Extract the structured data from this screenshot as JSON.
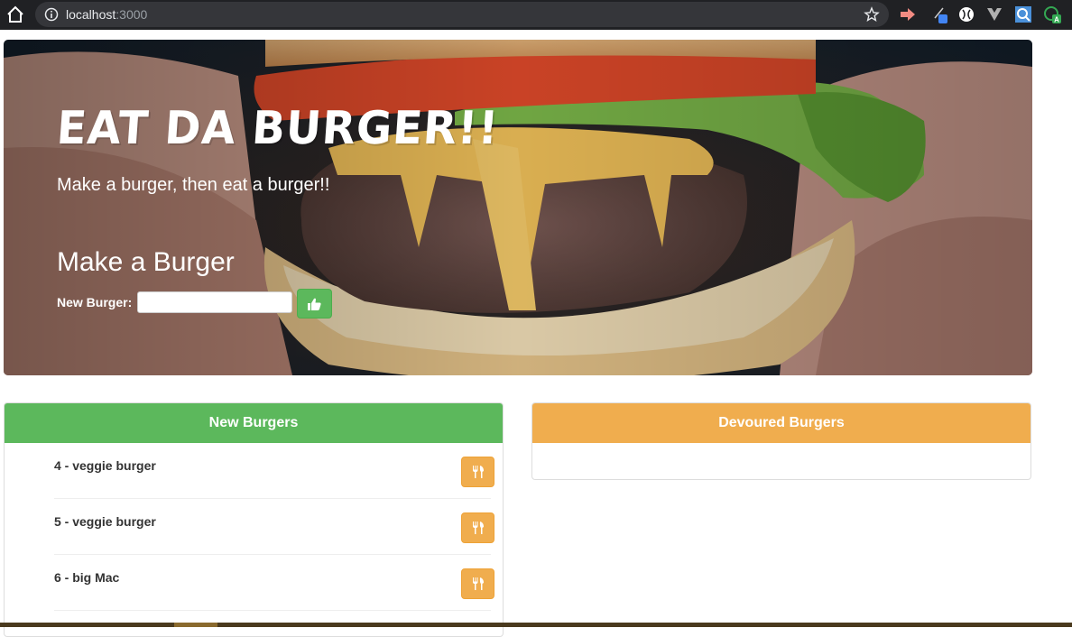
{
  "browser": {
    "url_host": "localhost",
    "url_port": ":3000"
  },
  "hero": {
    "title": "Eat Da Burger!!",
    "subtitle": "Make a burger, then eat a burger!!",
    "form_title": "Make a Burger",
    "input_label": "New Burger:",
    "input_value": "",
    "input_placeholder": "",
    "submit_icon": "thumbs-up-icon"
  },
  "panels": {
    "new": {
      "title": "New Burgers",
      "color": "#5cb85c",
      "items": [
        {
          "label": "4 - veggie burger",
          "icon": "cutlery-icon"
        },
        {
          "label": "5 - veggie burger",
          "icon": "cutlery-icon"
        },
        {
          "label": "6 - big Mac",
          "icon": "cutlery-icon"
        }
      ]
    },
    "devoured": {
      "title": "Devoured Burgers",
      "color": "#f0ad4e",
      "items": []
    }
  }
}
